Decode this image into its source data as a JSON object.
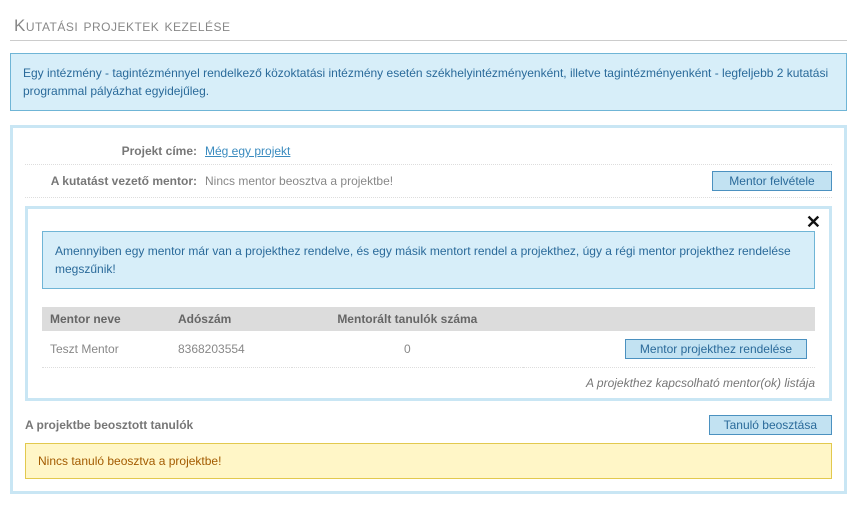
{
  "page": {
    "title": "Kutatási projektek kezelése"
  },
  "topInfo": "Egy intézmény - tagintézménnyel rendelkező közoktatási intézmény esetén székhelyintézményenként, illetve tagintézményenként - legfeljebb 2 kutatási programmal pályázhat egyidejűleg.",
  "project": {
    "titleLabel": "Projekt címe:",
    "titleLink": "Még egy projekt",
    "mentorLabel": "A kutatást vezető mentor:",
    "mentorValue": "Nincs mentor beosztva a projektbe!",
    "addMentorBtn": "Mentor felvétele"
  },
  "mentorPanel": {
    "info": "Amennyiben egy mentor már van a projekthez rendelve, és egy másik mentort rendel a projekthez, úgy a régi mentor projekthez rendelése megszűnik!",
    "columns": {
      "name": "Mentor neve",
      "tax": "Adószám",
      "students": "Mentorált tanulók száma",
      "action": ""
    },
    "rows": [
      {
        "name": "Teszt Mentor",
        "tax": "8368203554",
        "students": "0",
        "actionLabel": "Mentor projekthez rendelése"
      }
    ],
    "footnote": "A projekthez kapcsolható mentor(ok) listája"
  },
  "students": {
    "label": "A projektbe beosztott tanulók",
    "addBtn": "Tanuló beosztása",
    "warn": "Nincs tanuló beosztva a projektbe!"
  }
}
